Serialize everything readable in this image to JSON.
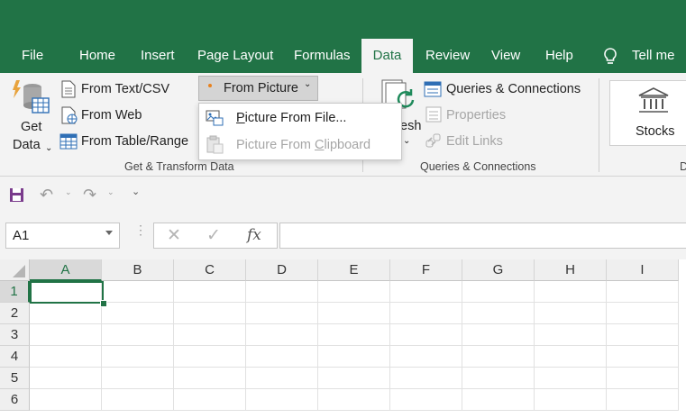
{
  "tabs": {
    "file": "File",
    "home": "Home",
    "insert": "Insert",
    "page_layout": "Page Layout",
    "formulas": "Formulas",
    "data": "Data",
    "review": "Review",
    "view": "View",
    "help": "Help",
    "tell_me": "Tell me w"
  },
  "ribbon": {
    "get_data_line1": "Get",
    "get_data_line2": "Data",
    "from_text_csv": "From Text/CSV",
    "from_web": "From Web",
    "from_table_range": "From Table/Range",
    "from_picture": "From Picture",
    "refresh_partial": "esh",
    "queries_connections": "Queries & Connections",
    "properties": "Properties",
    "edit_links": "Edit Links",
    "stocks": "Stocks",
    "group_get_transform": "Get & Transform Data",
    "group_queries": "Queries & Connections",
    "group_partial": "D"
  },
  "dropdown": {
    "picture_from_file": {
      "underline": "P",
      "rest": "icture From File..."
    },
    "picture_from_clipboard": {
      "before": "Picture From ",
      "underline": "C",
      "after": "lipboard"
    }
  },
  "formula_bar": {
    "name_box": "A1",
    "fx": "fx",
    "formula": ""
  },
  "grid": {
    "columns": [
      "A",
      "B",
      "C",
      "D",
      "E",
      "F",
      "G",
      "H",
      "I"
    ],
    "rows": [
      "1",
      "2",
      "3",
      "4",
      "5",
      "6"
    ],
    "selected": "A1"
  },
  "colors": {
    "accent": "#217346",
    "qat_save": "#7a3b8c"
  }
}
